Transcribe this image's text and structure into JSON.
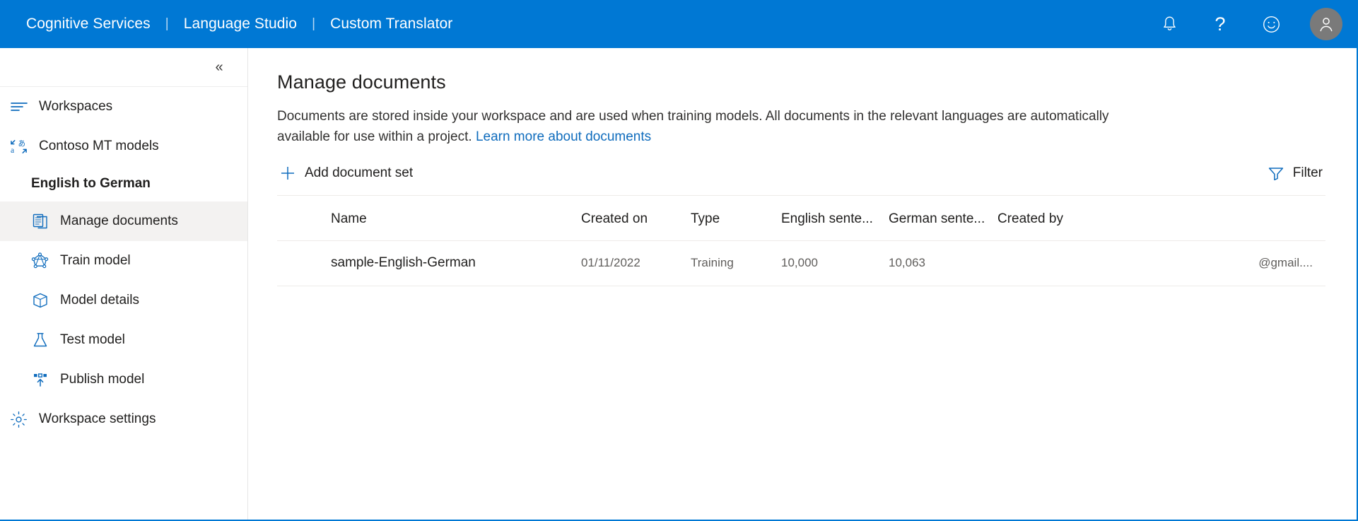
{
  "topbar": {
    "brand_items": [
      "Cognitive Services",
      "Language Studio",
      "Custom Translator"
    ],
    "separator": "|",
    "icons": {
      "notifications": "bell-icon",
      "help": "question-mark-icon",
      "feedback": "smiley-icon",
      "account": "person-avatar-icon"
    },
    "background_color": "#0078d4"
  },
  "sidebar": {
    "collapse_glyph": "«",
    "items": [
      {
        "label": "Workspaces",
        "icon": "list-lines-icon",
        "selected": false,
        "indent": false
      },
      {
        "label": "Contoso MT models",
        "icon": "translate-icon",
        "selected": false,
        "indent": false
      }
    ],
    "group_title": "English to German",
    "model_items": [
      {
        "label": "Manage documents",
        "icon": "document-icon",
        "selected": true,
        "indent": true
      },
      {
        "label": "Train model",
        "icon": "neural-network-icon",
        "selected": false,
        "indent": true
      },
      {
        "label": "Model details",
        "icon": "box-icon",
        "selected": false,
        "indent": true
      },
      {
        "label": "Test model",
        "icon": "flask-icon",
        "selected": false,
        "indent": true
      },
      {
        "label": "Publish model",
        "icon": "publish-upload-icon",
        "selected": false,
        "indent": true
      }
    ],
    "footer_items": [
      {
        "label": "Workspace settings",
        "icon": "gear-icon",
        "selected": false,
        "indent": false
      }
    ],
    "selected_background": "#f3f2f1",
    "icon_color": "#0f6cbd"
  },
  "main": {
    "title": "Manage documents",
    "description": "Documents are stored inside your workspace and are used when training models. All documents in the relevant languages are automatically available for use within a project.",
    "learn_more_link": "Learn more about documents",
    "add_button": "Add document set",
    "add_icon": "plus-icon",
    "filter_button": "Filter",
    "filter_icon": "funnel-icon",
    "link_color": "#0f6cbd"
  },
  "table": {
    "columns": [
      "Name",
      "Created on",
      "Type",
      "English sente...",
      "German sente...",
      "Created by"
    ],
    "rows": [
      {
        "name": "sample-English-German",
        "created_on": "01/11/2022",
        "type": "Training",
        "english_sentences": "10,000",
        "german_sentences": "10,063",
        "created_by": "@gmail...."
      }
    ]
  }
}
